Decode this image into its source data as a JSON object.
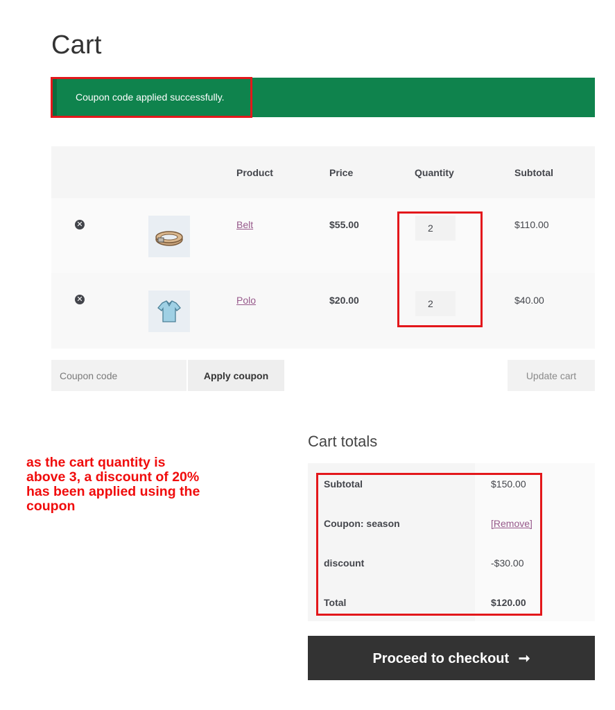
{
  "page": {
    "title": "Cart"
  },
  "notice": {
    "message": "Coupon code applied successfully."
  },
  "table": {
    "headers": {
      "product": "Product",
      "price": "Price",
      "quantity": "Quantity",
      "subtotal": "Subtotal"
    },
    "rows": [
      {
        "remove_icon": "close-circle-icon",
        "remove_glyph": "✕",
        "product": "Belt",
        "price": "$55.00",
        "quantity": "2",
        "subtotal": "$110.00"
      },
      {
        "remove_icon": "close-circle-icon",
        "remove_glyph": "✕",
        "product": "Polo",
        "price": "$20.00",
        "quantity": "2",
        "subtotal": "$40.00"
      }
    ]
  },
  "coupon": {
    "placeholder": "Coupon code",
    "apply_label": "Apply coupon"
  },
  "update_label": "Update cart",
  "totals": {
    "title": "Cart totals",
    "rows": [
      {
        "label": "Subtotal",
        "value": "$150.00"
      },
      {
        "label": "Coupon: season",
        "value": "[Remove]"
      },
      {
        "label": "discount",
        "value": "-$30.00"
      },
      {
        "label": "Total",
        "value": "$120.00"
      }
    ]
  },
  "checkout": {
    "label": "Proceed to checkout",
    "arrow": "➞"
  },
  "annotation": {
    "lines": [
      "as the cart quantity is",
      "above 3, a discount of 20%",
      "has been applied using the",
      "coupon"
    ]
  },
  "colors": {
    "accent": "#96588a",
    "notice": "#0f834d",
    "highlight": "#e3171b",
    "annotation": "#f00c0c",
    "button_dark": "#333333"
  }
}
